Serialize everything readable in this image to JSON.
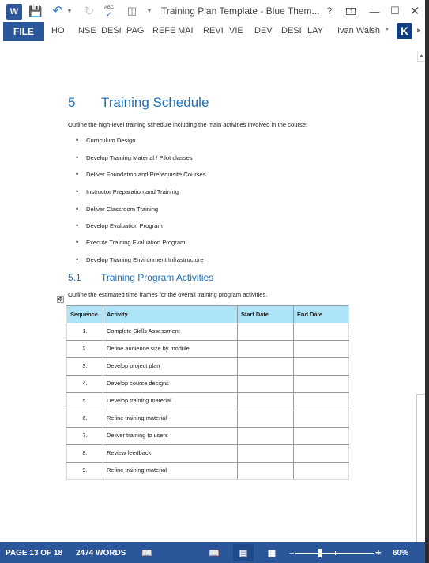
{
  "titlebar": {
    "app_icon": "word-icon",
    "title": "Training Plan Template - Blue Them...",
    "help": "?",
    "minimize": "—",
    "maximize": "☐",
    "close": "✕"
  },
  "ribbon": {
    "file_label": "FILE",
    "tabs": [
      "HO",
      "INSE",
      "DESI",
      "PAG",
      "REFE",
      "MAI",
      "REVI",
      "VIE",
      "DEV",
      "DESI",
      "LAY"
    ],
    "user_name": "Ivan Walsh",
    "avatar_letter": "K"
  },
  "document": {
    "heading1": {
      "number": "5",
      "text": "Training Schedule"
    },
    "intro": "Outline the high-level training schedule including the main activities involved in the course:",
    "bullets": [
      "Curriculum Design",
      "Develop Training Material / Pilot classes",
      "Deliver Foundation and Prerequisite Courses",
      "Instructor Preparation and Training",
      "Deliver Classroom Training",
      "Develop Evaluation Program",
      "Execute Training Evaluation Program",
      "Develop Training Environment Infrastructure"
    ],
    "heading2": {
      "number": "5.1",
      "text": "Training Program Activities"
    },
    "table_intro": "Outline the estimated time frames for the overall training program activities.",
    "table": {
      "headers": [
        "Sequence",
        "Activity",
        "Start Date",
        "End Date"
      ],
      "header_color": "#aee4f7",
      "rows": [
        {
          "seq": "1.",
          "activity": "Complete Skills Assessment",
          "start": "",
          "end": ""
        },
        {
          "seq": "2.",
          "activity": "Define audience size by module",
          "start": "",
          "end": ""
        },
        {
          "seq": "3.",
          "activity": "Develop project plan",
          "start": "",
          "end": ""
        },
        {
          "seq": "4.",
          "activity": "Develop course designs",
          "start": "",
          "end": ""
        },
        {
          "seq": "5.",
          "activity": "Develop training material",
          "start": "",
          "end": ""
        },
        {
          "seq": "6.",
          "activity": "Refine training material",
          "start": "",
          "end": ""
        },
        {
          "seq": "7.",
          "activity": "Deliver training to users",
          "start": "",
          "end": ""
        },
        {
          "seq": "8.",
          "activity": "Review feedback",
          "start": "",
          "end": ""
        },
        {
          "seq": "9.",
          "activity": "Refine training material",
          "start": "",
          "end": ""
        }
      ]
    }
  },
  "statusbar": {
    "page": "PAGE 13 OF 18",
    "words": "2474 WORDS",
    "zoom_percent": "60%",
    "zoom_value": 60,
    "accent_color": "#2b579a"
  }
}
